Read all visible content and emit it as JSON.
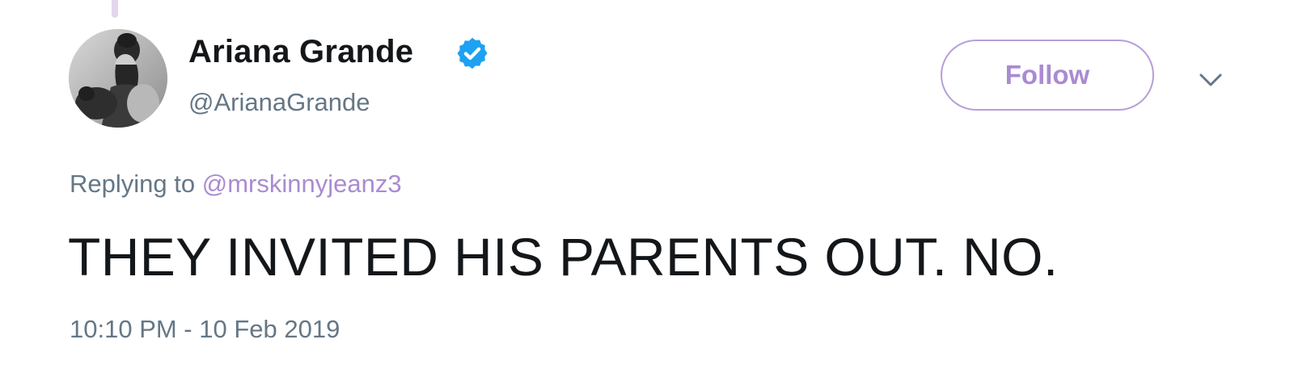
{
  "tweet": {
    "author": {
      "display_name": "Ariana Grande",
      "username": "@ArianaGrande",
      "verified": true,
      "verified_icon": "verified-badge-icon",
      "avatar_icon": "avatar-photo"
    },
    "follow_label": "Follow",
    "menu_icon": "chevron-down-icon",
    "reply": {
      "prefix": "Replying to",
      "handle": "@mrskinnyjeanz3"
    },
    "text": "THEY INVITED HIS PARENTS OUT. NO.",
    "timestamp": "10:10 PM - 10 Feb 2019"
  },
  "colors": {
    "accent": "#A98BD2",
    "verified_blue": "#1DA1F2",
    "secondary_text": "#657786",
    "primary_text": "#14171A"
  }
}
